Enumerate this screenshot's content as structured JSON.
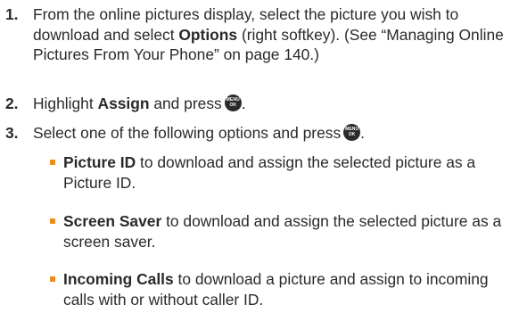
{
  "steps": [
    {
      "number": "1.",
      "pre": "From the online pictures display, select the picture you wish to download and select ",
      "bold": "Options",
      "post": " (right softkey). (See “Managing Online Pictures From Your Phone” on page 140.)"
    },
    {
      "number": "2.",
      "pre": "Highlight ",
      "bold": "Assign",
      "post": " and press"
    },
    {
      "number": "3.",
      "pre": "Select one of the following options and press"
    }
  ],
  "menu_key": {
    "top": "MENU",
    "bottom": "OK",
    "icon": "menu-ok-key-icon"
  },
  "options": [
    {
      "bold": "Picture ID",
      "text": " to download and assign the selected picture as a Picture ID."
    },
    {
      "bold": "Screen Saver",
      "text": " to download and assign the selected picture as a screen saver."
    },
    {
      "bold": "Incoming Calls",
      "text": " to download a picture and assign to incoming calls with or without caller ID."
    }
  ],
  "colors": {
    "text": "#2a2a2a",
    "bullet": "#f08c1e",
    "key": "#2b2b2b"
  }
}
